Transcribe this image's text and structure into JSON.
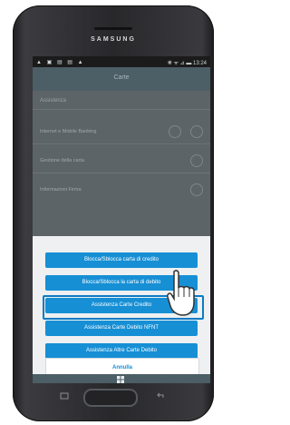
{
  "device": {
    "brand": "SAMSUNG"
  },
  "statusbar": {
    "left": "▲ ▣ ▤ ▤ ▲",
    "right": "❋ ᯤ ⊿ ▬ 13:24"
  },
  "appbar": {
    "title": "Carte"
  },
  "list": {
    "section": "Assistenza",
    "rows": [
      {
        "label": "Internet e Mobile Banking"
      },
      {
        "label": "Gestione della carta"
      },
      {
        "label": "Informazioni Firma"
      }
    ]
  },
  "sheet": {
    "buttons": [
      {
        "label": "Blocca/Sblocca carta di credito"
      },
      {
        "label": "Blocca/Sblocca la carta di debito"
      },
      {
        "label": "Assistenza Carte Credito"
      },
      {
        "label": "Assistenza Carte Debito NFNT"
      },
      {
        "label": "Assistenza Altre Carte Debito"
      }
    ],
    "cancel": "Annulla"
  },
  "icons": {
    "bottombar": "grid-icon",
    "touch": "touch-indicator",
    "hand": "pointing-hand-icon"
  },
  "colors": {
    "accent": "#168fd5",
    "appbar": "#4c5e66"
  }
}
